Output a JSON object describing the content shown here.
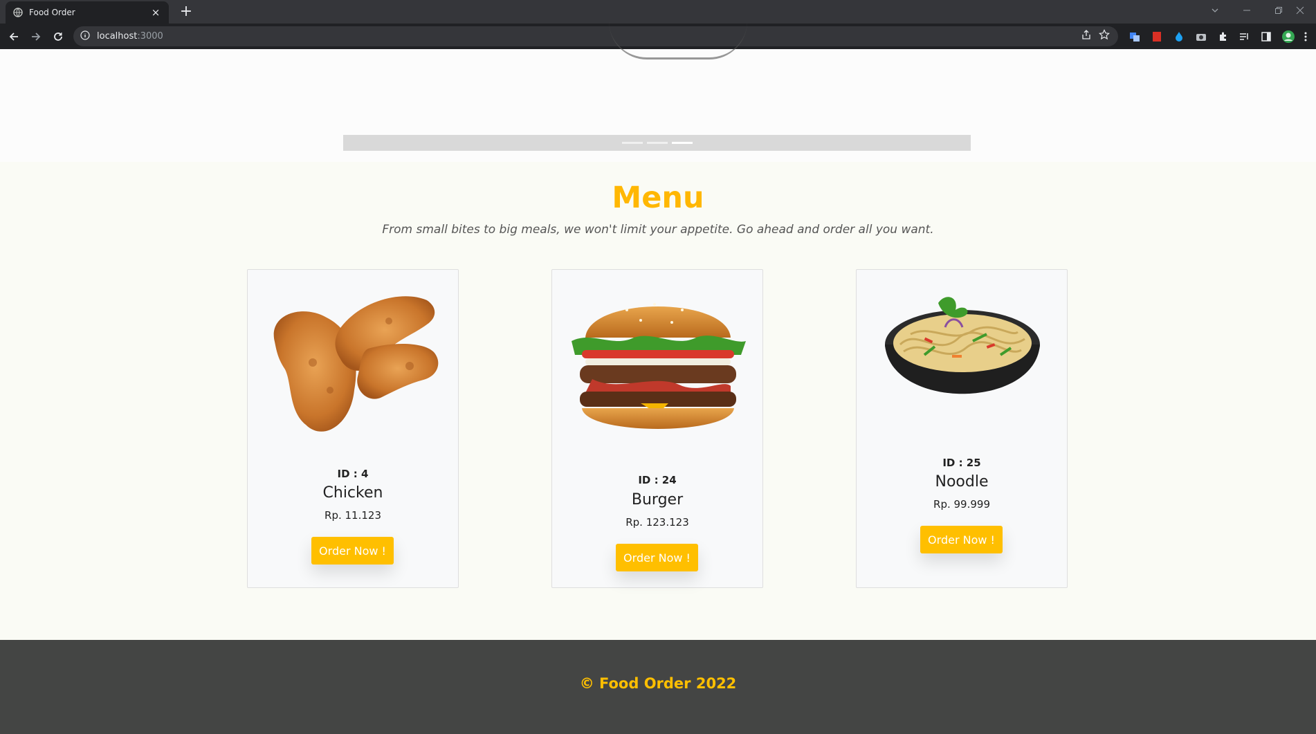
{
  "browser": {
    "tab_title": "Food Order",
    "tab_close": "×",
    "new_tab": "+",
    "url_host": "localhost",
    "url_port": ":3000"
  },
  "menu": {
    "title": "Menu",
    "subtitle": "From small bites to big meals, we won't limit your appetite. Go ahead and order all you want."
  },
  "carousel": {
    "slide_count": 3,
    "active_index": 2
  },
  "items": [
    {
      "id_label": "ID : 4",
      "name": "Chicken",
      "price": "Rp. 11.123",
      "button": "Order Now !",
      "image": "fried-chicken-image"
    },
    {
      "id_label": "ID : 24",
      "name": "Burger",
      "price": "Rp. 123.123",
      "button": "Order Now !",
      "image": "burger-image"
    },
    {
      "id_label": "ID : 25",
      "name": "Noodle",
      "price": "Rp. 99.999",
      "button": "Order Now !",
      "image": "noodle-bowl-image"
    }
  ],
  "footer": {
    "text": "© Food Order 2022"
  },
  "colors": {
    "accent": "#ffbf00",
    "footer_bg": "#444544",
    "page_bg": "#fafbf5"
  }
}
